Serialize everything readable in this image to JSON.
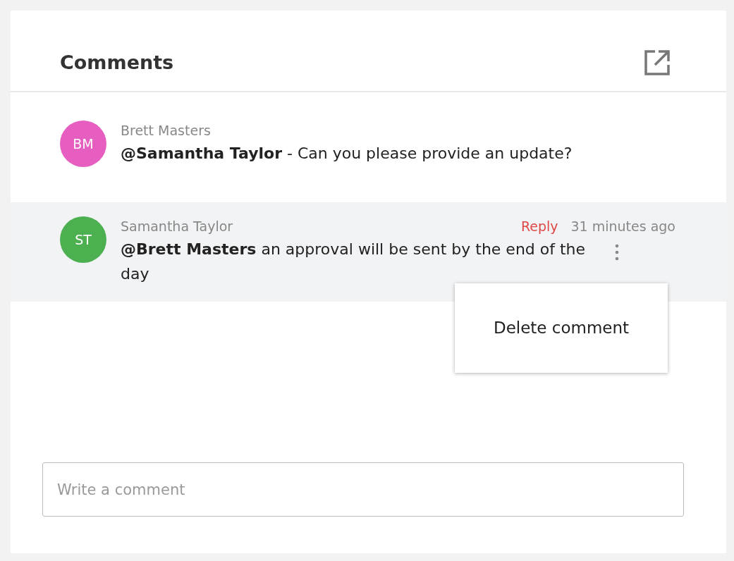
{
  "panel": {
    "title": "Comments"
  },
  "comments": [
    {
      "initials": "BM",
      "color": "#e55ec0",
      "author": "Brett Masters",
      "text": "**@Samantha Taylor** - Can you please provide an update?",
      "selected": false
    },
    {
      "initials": "ST",
      "color": "#4caf50",
      "author": "Samantha Taylor",
      "reply": "Reply",
      "time": "31 minutes ago",
      "text": "**@Brett Masters** an approval will be sent by the end of the day",
      "selected": true,
      "menu": {
        "items": [
          "Delete comment"
        ]
      }
    }
  ],
  "composer": {
    "placeholder": "Write a comment"
  }
}
